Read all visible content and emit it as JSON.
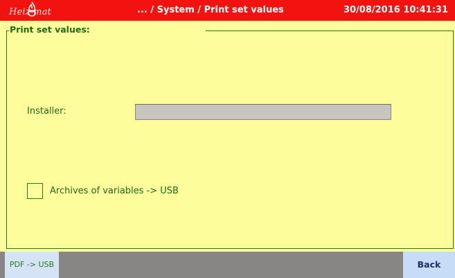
{
  "header": {
    "logo_text": "Heiz mat",
    "breadcrumb": "... / System / Print set values",
    "datetime": "30/08/2016 10:41:31"
  },
  "panel": {
    "title": "Print set values:",
    "installer_label": "Installer:",
    "installer_value": "",
    "archive_checkbox_label": "Archives of variables -> USB",
    "archive_checked": false
  },
  "footer": {
    "pdf_button": "PDF -> USB",
    "back_button": "Back"
  },
  "colors": {
    "header_bg": "#f2120f",
    "panel_bg": "#fdfd9c",
    "accent_green": "#1f6b14",
    "footer_bg": "#888684",
    "button_bg": "#c7dcf7"
  }
}
